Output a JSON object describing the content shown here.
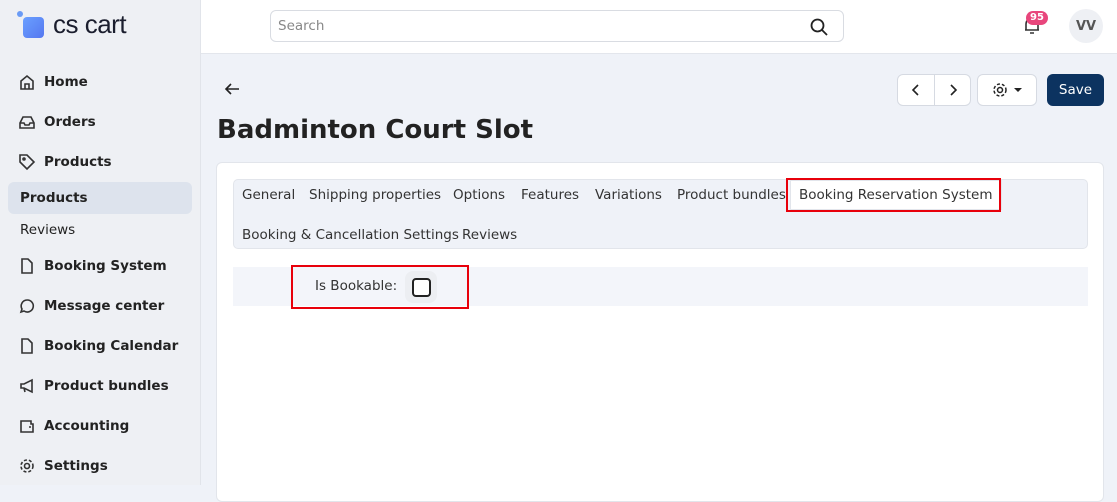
{
  "brand": {
    "name": "cs cart"
  },
  "sidebar": {
    "items": [
      {
        "label": "Home",
        "icon": "home-icon"
      },
      {
        "label": "Orders",
        "icon": "inbox-icon"
      },
      {
        "label": "Products",
        "icon": "tag-icon"
      },
      {
        "label": "Products",
        "sub": true,
        "active": true
      },
      {
        "label": "Reviews",
        "sub": true
      },
      {
        "label": "Booking System",
        "icon": "file-icon"
      },
      {
        "label": "Message center",
        "icon": "chat-icon"
      },
      {
        "label": "Booking Calendar",
        "icon": "file-icon"
      },
      {
        "label": "Product bundles",
        "icon": "megaphone-icon"
      },
      {
        "label": "Accounting",
        "icon": "wallet-icon"
      },
      {
        "label": "Settings",
        "icon": "gear-icon"
      }
    ]
  },
  "header": {
    "search_placeholder": "Search",
    "notifications": "95",
    "avatar": "VV"
  },
  "toolbar": {
    "save_label": "Save"
  },
  "page": {
    "title": "Badminton Court Slot"
  },
  "tabs": [
    "General",
    "Shipping properties",
    "Options",
    "Features",
    "Variations",
    "Product bundles",
    "Booking Reservation System",
    "Booking & Cancellation Settings",
    "Reviews"
  ],
  "active_tab": "Booking Reservation System",
  "form": {
    "is_bookable_label": "Is Bookable:",
    "is_bookable": false
  },
  "colors": {
    "save": "#0c3360",
    "highlight": "#e8000b",
    "badge": "#e8467c"
  }
}
